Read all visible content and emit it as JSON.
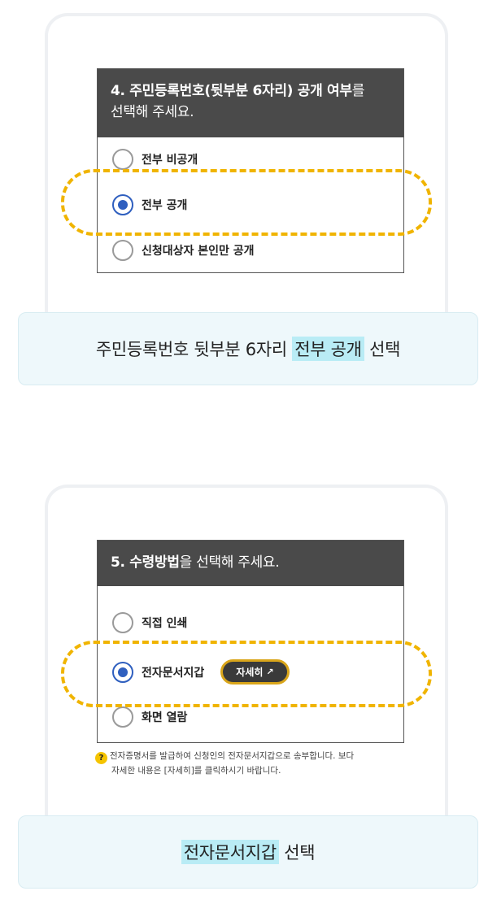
{
  "panel1": {
    "header_bold": "4. 주민등록번호(뒷부분 6자리) 공개 여부",
    "header_rest": "를",
    "header_line2": "선택해 주세요.",
    "options": [
      {
        "label": "전부 비공개",
        "selected": false
      },
      {
        "label": "전부 공개",
        "selected": true
      },
      {
        "label": "신청대상자 본인만 공개",
        "selected": false
      }
    ],
    "caption_before": "주민등록번호 뒷부분 6자리",
    "caption_highlight": "전부 공개",
    "caption_after": "선택"
  },
  "panel2": {
    "header_bold": "5. 수령방법",
    "header_rest": "을 선택해 주세요.",
    "options": [
      {
        "label": "직접 인쇄",
        "selected": false
      },
      {
        "label": "전자문서지갑",
        "selected": true
      },
      {
        "label": "화면 열람",
        "selected": false
      }
    ],
    "detail_button": "자세히",
    "note_line1": "전자증명서를 발급하여 신청인의 전자문서지갑으로 송부합니다. 보다",
    "note_line2": "자세한 내용은 [자세히]를 클릭하시기 바랍니다.",
    "caption_highlight": "전자문서지갑",
    "caption_after": "선택"
  },
  "colors": {
    "header_bg": "#4a4a4a",
    "radio_selected": "#2f5fbf",
    "dashed_highlight": "#f0b400",
    "caption_bg": "#eef8fb",
    "caption_mark": "#b9ecf5"
  },
  "icons": {
    "external_link": "external-link-icon",
    "help": "question-icon"
  }
}
